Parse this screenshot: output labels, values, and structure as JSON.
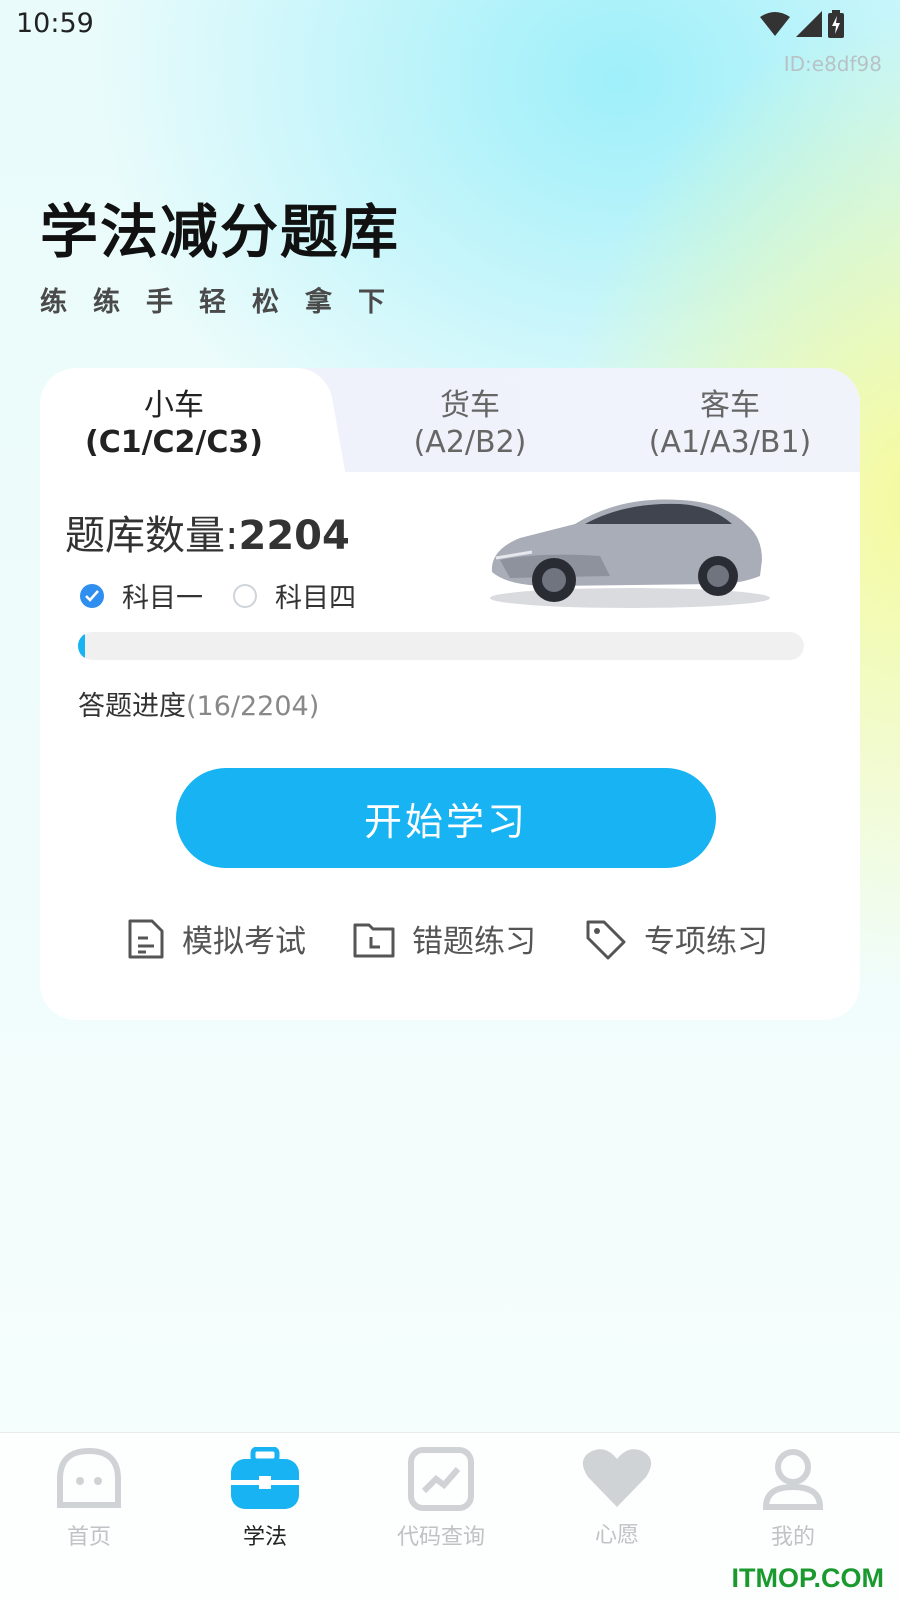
{
  "status_bar": {
    "time": "10:59",
    "icons": [
      "wifi-icon",
      "signal-icon",
      "battery-charging-icon"
    ]
  },
  "device_id": "ID:e8df98",
  "hero": {
    "title": "学法减分题库",
    "subtitle": "练练手轻松拿下"
  },
  "tabs": [
    {
      "name": "小车",
      "sub": "(C1/C2/C3)",
      "selected": true
    },
    {
      "name": "货车",
      "sub": "(A2/B2)",
      "selected": false
    },
    {
      "name": "客车",
      "sub": "(A1/A3/B1)",
      "selected": false
    }
  ],
  "bank": {
    "label": "题库数量:",
    "count": "2204"
  },
  "subjects": [
    {
      "label": "科目一",
      "selected": true
    },
    {
      "label": "科目四",
      "selected": false
    }
  ],
  "progress": {
    "label": "答题进度",
    "value_text": "(16/2204)",
    "done": 16,
    "total": 2204
  },
  "start_button": "开始学习",
  "actions": [
    {
      "label": "模拟考试",
      "icon": "exam-doc-icon"
    },
    {
      "label": "错题练习",
      "icon": "folder-clock-icon"
    },
    {
      "label": "专项练习",
      "icon": "tag-icon"
    }
  ],
  "tabbar": [
    {
      "label": "首页",
      "icon": "home-face-icon",
      "active": false
    },
    {
      "label": "学法",
      "icon": "toolbox-icon",
      "active": true
    },
    {
      "label": "代码查询",
      "icon": "chart-up-icon",
      "active": false
    },
    {
      "label": "心愿",
      "icon": "heart-icon",
      "active": false
    },
    {
      "label": "我的",
      "icon": "user-icon",
      "active": false
    }
  ],
  "watermark": "ITMOP.COM",
  "colors": {
    "accent": "#17b3f2",
    "radio_on": "#2e8ff0",
    "inactive": "#bfc3c5"
  }
}
